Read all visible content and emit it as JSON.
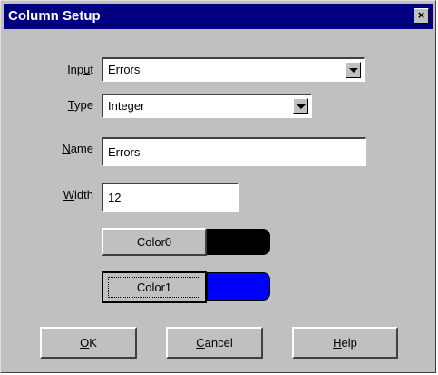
{
  "dialog": {
    "title": "Column Setup"
  },
  "form": {
    "input": {
      "label_pre": "Inp",
      "label_u": "u",
      "label_post": "t",
      "value": "Errors"
    },
    "type": {
      "label_u": "T",
      "label_post": "ype",
      "value": "Integer"
    },
    "name": {
      "label_u": "N",
      "label_post": "ame",
      "value": "Errors"
    },
    "width": {
      "label_u": "W",
      "label_post": "idth",
      "value": "12"
    }
  },
  "colors": [
    {
      "label": "Color0",
      "hex": "#000000"
    },
    {
      "label": "Color1",
      "hex": "#0000ff"
    }
  ],
  "buttons": {
    "ok": {
      "u": "O",
      "rest": "K"
    },
    "cancel": {
      "u": "C",
      "rest": "ancel"
    },
    "help": {
      "u": "H",
      "rest": "elp"
    }
  },
  "icons": {
    "close": "close-icon",
    "dropdown": "chevron-down-icon"
  }
}
